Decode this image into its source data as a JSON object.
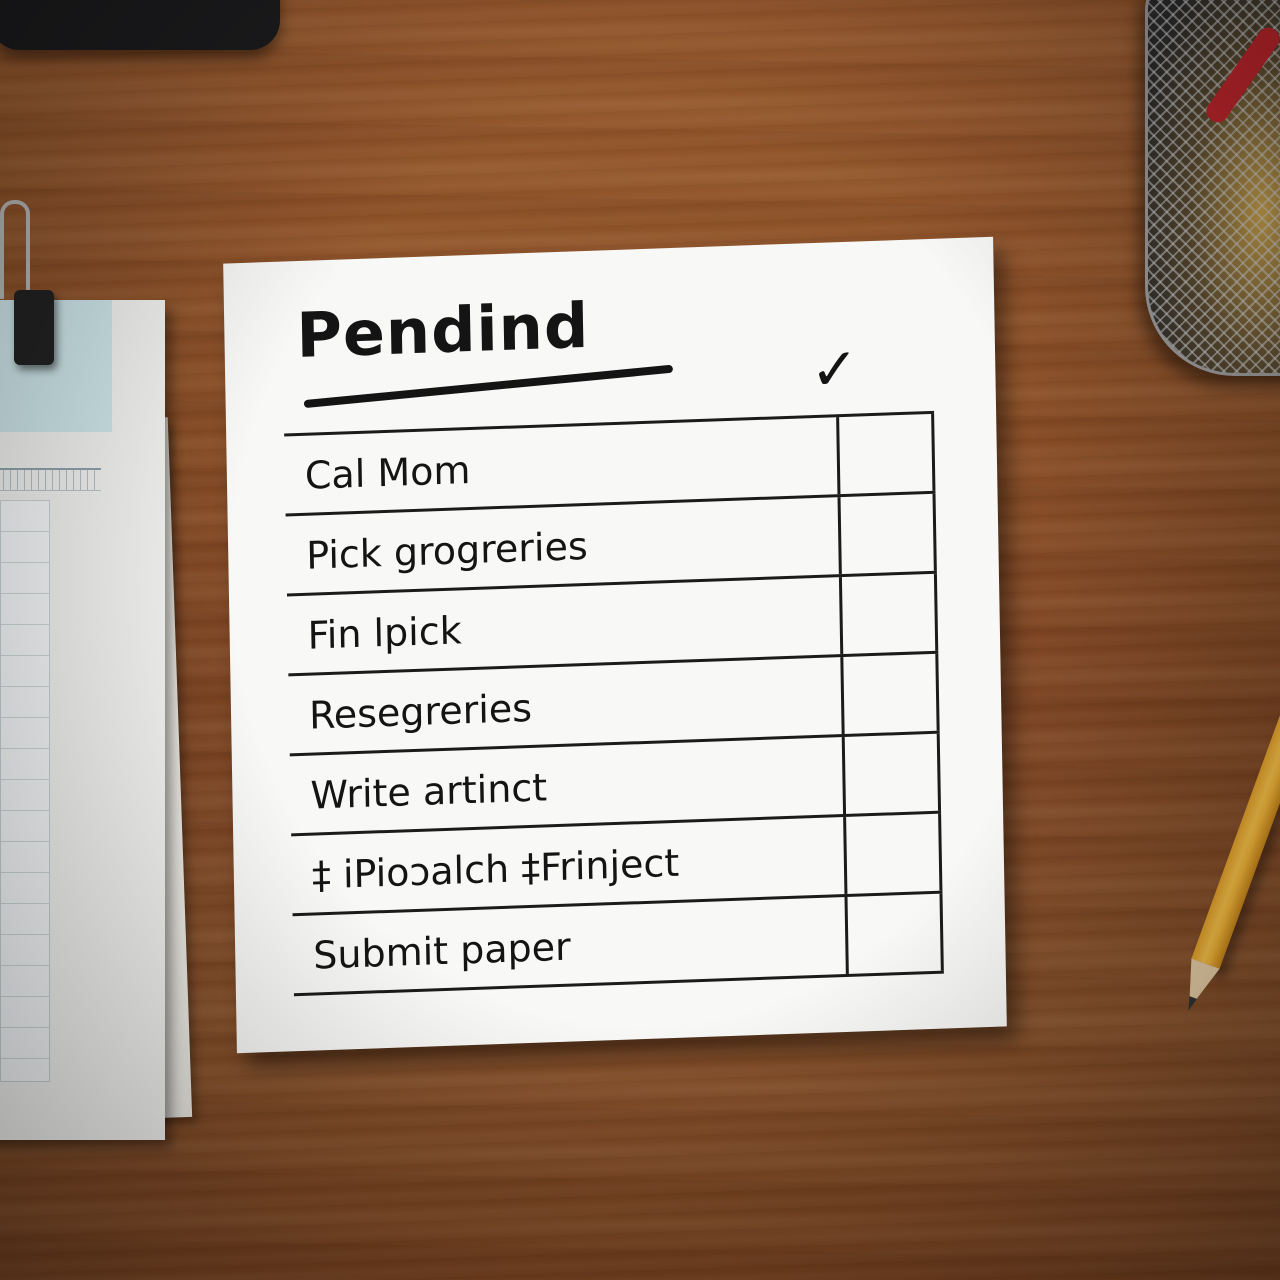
{
  "note": {
    "title": "Pendind",
    "check_symbol": "✓",
    "tasks": [
      "Cal Mom",
      "Pick grogreries",
      "Fin lpick",
      "Resegreries",
      "Write artinct",
      "‡ iPioɔalch ‡Frinject",
      "Submit paper"
    ]
  },
  "scene": {
    "icons": [
      "binder-clip",
      "pencil",
      "pencil-cup",
      "check-mark"
    ]
  }
}
